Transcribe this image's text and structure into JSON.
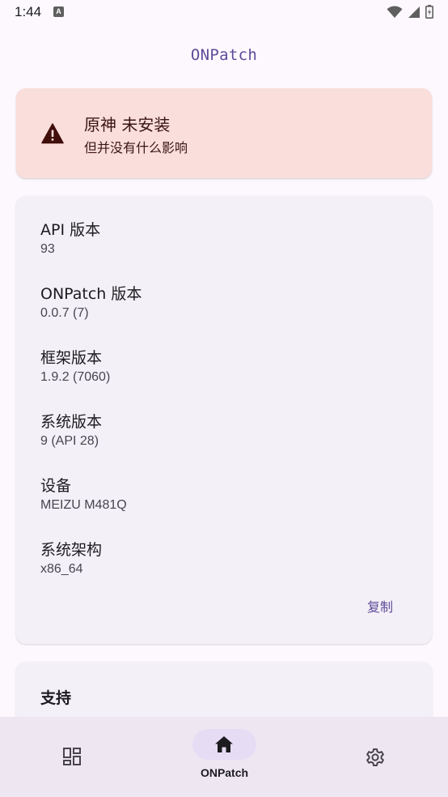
{
  "status_bar": {
    "time": "1:44",
    "notification_icon": "A",
    "icons": [
      "wifi-icon",
      "cell-signal-icon",
      "battery-icon"
    ]
  },
  "app": {
    "title": "ONPatch"
  },
  "warning": {
    "icon": "warning-icon",
    "title": "原神 未安装",
    "subtitle": "但并没有什么影响"
  },
  "info": {
    "items": [
      {
        "label": "API 版本",
        "value": "93"
      },
      {
        "label": "ONPatch 版本",
        "value": "0.0.7 (7)"
      },
      {
        "label": "框架版本",
        "value": "1.9.2 (7060)"
      },
      {
        "label": "系统版本",
        "value": "9 (API 28)"
      },
      {
        "label": "设备",
        "value": "MEIZU M481Q"
      },
      {
        "label": "系统架构",
        "value": "x86_64"
      }
    ],
    "copy_label": "复制"
  },
  "support": {
    "title": "支持"
  },
  "nav": {
    "items": [
      {
        "icon": "dashboard-icon",
        "label": ""
      },
      {
        "icon": "home-icon",
        "label": "ONPatch",
        "selected": true
      },
      {
        "icon": "gear-icon",
        "label": ""
      }
    ]
  },
  "colors": {
    "accent": "#5e4b9b",
    "warning_bg": "#f9dedc",
    "card_bg": "#f4f0f7",
    "nav_bg": "#eee7f2",
    "nav_pill": "#e6ddf5"
  }
}
